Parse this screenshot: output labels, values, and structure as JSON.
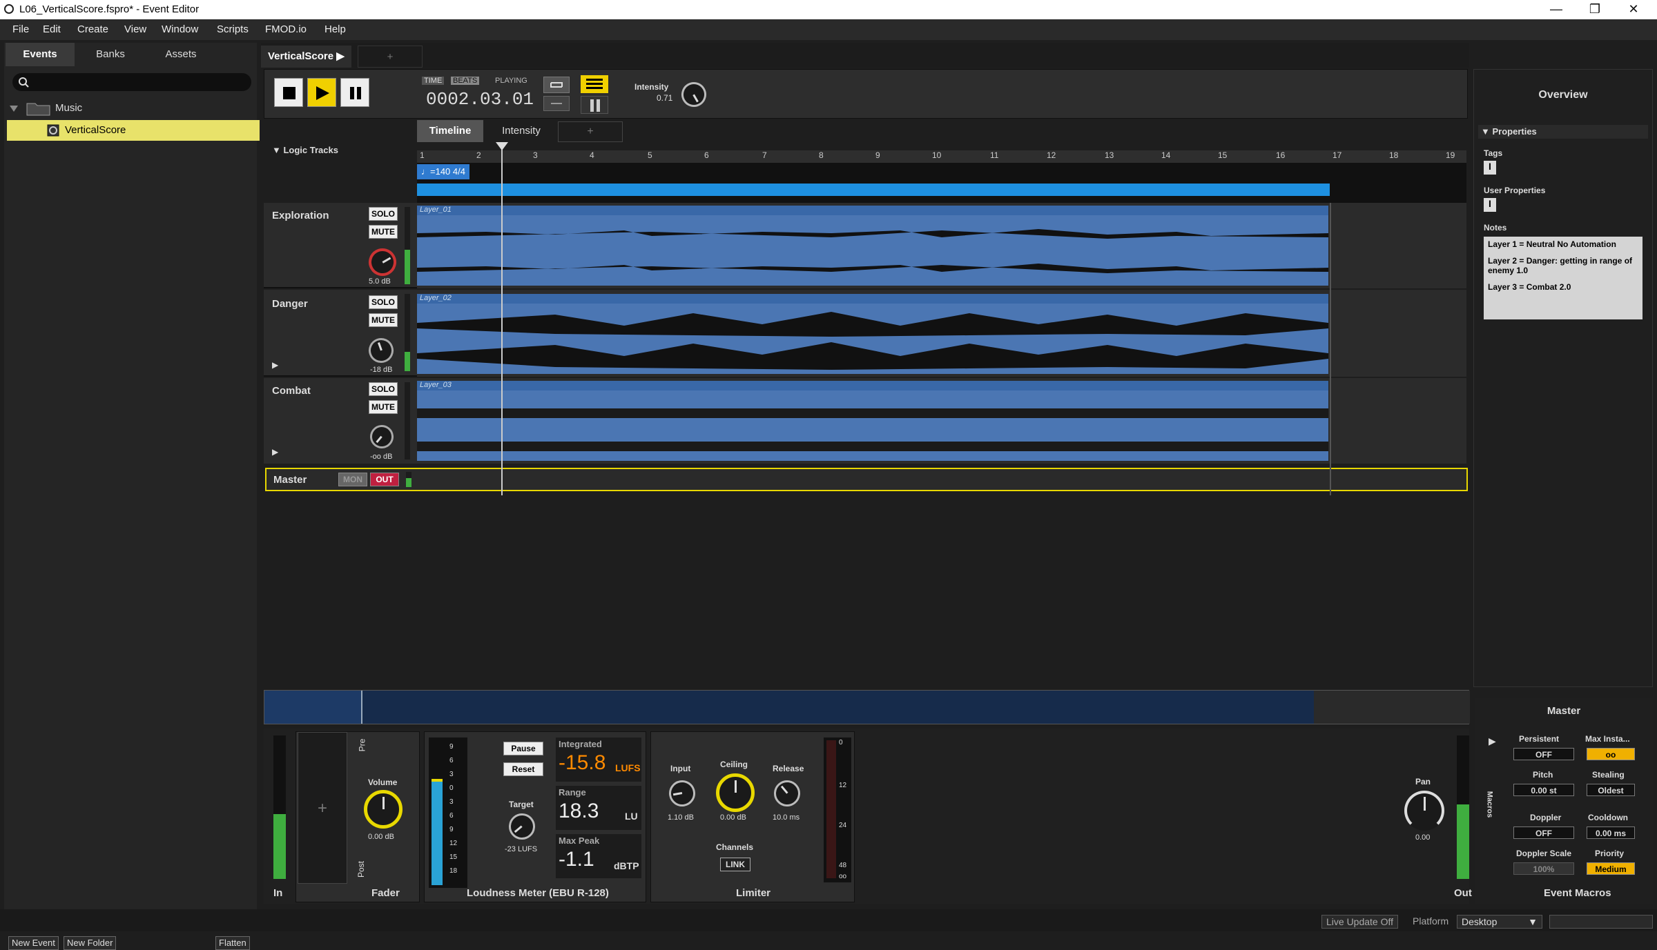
{
  "window": {
    "title": "L06_VerticalScore.fspro* - Event Editor",
    "controls": {
      "minimize": "—",
      "maximize": "❐",
      "close": "✕"
    }
  },
  "menu": [
    "File",
    "Edit",
    "Create",
    "View",
    "Window",
    "Scripts",
    "FMOD.io",
    "Help"
  ],
  "browser": {
    "tabs": [
      "Events",
      "Banks",
      "Assets"
    ],
    "search_placeholder": "",
    "folder": "Music",
    "event": "VerticalScore",
    "buttons": {
      "new_event": "New Event",
      "new_folder": "New Folder",
      "flatten": "Flatten"
    }
  },
  "editor": {
    "event_tab": "VerticalScore",
    "add_tab": "+",
    "transport": {
      "time_label": "TIME",
      "beats_label": "BEATS",
      "state": "PLAYING",
      "position": "0002.03.01",
      "intensity_label": "Intensity",
      "intensity_value": "0.71"
    },
    "view_tabs": [
      "Timeline",
      "Intensity",
      "+"
    ],
    "logic_tracks_label": "Logic Tracks",
    "tempo_marker": "♩=140 4/4",
    "ruler": [
      "1",
      "2",
      "3",
      "4",
      "5",
      "6",
      "7",
      "8",
      "9",
      "10",
      "11",
      "12",
      "13",
      "14",
      "15",
      "16",
      "17",
      "18",
      "19"
    ],
    "tracks": [
      {
        "name": "Exploration",
        "solo": "SOLO",
        "mute": "MUTE",
        "volume": "5.0 dB",
        "region": "Layer_01",
        "meter_level": 0.45
      },
      {
        "name": "Danger",
        "solo": "SOLO",
        "mute": "MUTE",
        "volume": "-18 dB",
        "region": "Layer_02",
        "meter_level": 0.25
      },
      {
        "name": "Combat",
        "solo": "SOLO",
        "mute": "MUTE",
        "volume": "-oo dB",
        "region": "Layer_03",
        "meter_level": 0.0
      }
    ],
    "master": {
      "name": "Master",
      "mon": "MON",
      "out": "OUT"
    }
  },
  "overview": {
    "title": "Overview",
    "properties_label": "Properties",
    "tags_label": "Tags",
    "user_properties_label": "User Properties",
    "notes_label": "Notes",
    "notes": [
      "Layer 1 = Neutral No Automation",
      "Layer 2 = Danger: getting in range of enemy 1.0",
      "Layer 3 = Combat 2.0"
    ]
  },
  "deck": {
    "in_label": "In",
    "fader": {
      "label": "Fader",
      "volume_label": "Volume",
      "volume_value": "0.00 dB",
      "pre": "Pre",
      "post": "Post",
      "add": "+"
    },
    "loudness": {
      "label": "Loudness Meter (EBU R-128)",
      "pause": "Pause",
      "reset": "Reset",
      "target_label": "Target",
      "target_value": "-23 LUFS",
      "integrated_label": "Integrated",
      "integrated_value": "-15.8",
      "integrated_unit": "LUFS",
      "range_label": "Range",
      "range_value": "18.3",
      "range_unit": "LU",
      "maxpeak_label": "Max Peak",
      "maxpeak_value": "-1.1",
      "maxpeak_unit": "dBTP",
      "scale": [
        "9",
        "6",
        "3",
        "0",
        "3",
        "6",
        "9",
        "12",
        "15",
        "18"
      ]
    },
    "limiter": {
      "label": "Limiter",
      "input_label": "Input",
      "input_value": "1.10 dB",
      "ceiling_label": "Ceiling",
      "ceiling_value": "0.00 dB",
      "release_label": "Release",
      "release_value": "10.0 ms",
      "channels_label": "Channels",
      "link": "LINK",
      "scale": [
        "0",
        "12",
        "24",
        "48",
        "oo"
      ]
    },
    "out": {
      "label": "Out",
      "pan_label": "Pan",
      "pan_value": "0.00"
    },
    "macros": {
      "title": "Master",
      "label": "Event Macros",
      "side": "Macros",
      "persistent_label": "Persistent",
      "persistent_value": "OFF",
      "max_instances_label": "Max Insta...",
      "max_instances_value": "oo",
      "pitch_label": "Pitch",
      "pitch_value": "0.00 st",
      "stealing_label": "Stealing",
      "stealing_value": "Oldest",
      "doppler_label": "Doppler",
      "doppler_value": "OFF",
      "cooldown_label": "Cooldown",
      "cooldown_value": "0.00 ms",
      "doppler_scale_label": "Doppler Scale",
      "doppler_scale_value": "100%",
      "priority_label": "Priority",
      "priority_value": "Medium"
    }
  },
  "status": {
    "live_update": "Live Update Off",
    "platform_label": "Platform",
    "platform_value": "Desktop"
  },
  "colors": {
    "accent_yellow": "#f0d000",
    "region_blue": "#4b76b3",
    "loudness_orange": "#ff8a00",
    "meter_green": "#3fae3f"
  }
}
